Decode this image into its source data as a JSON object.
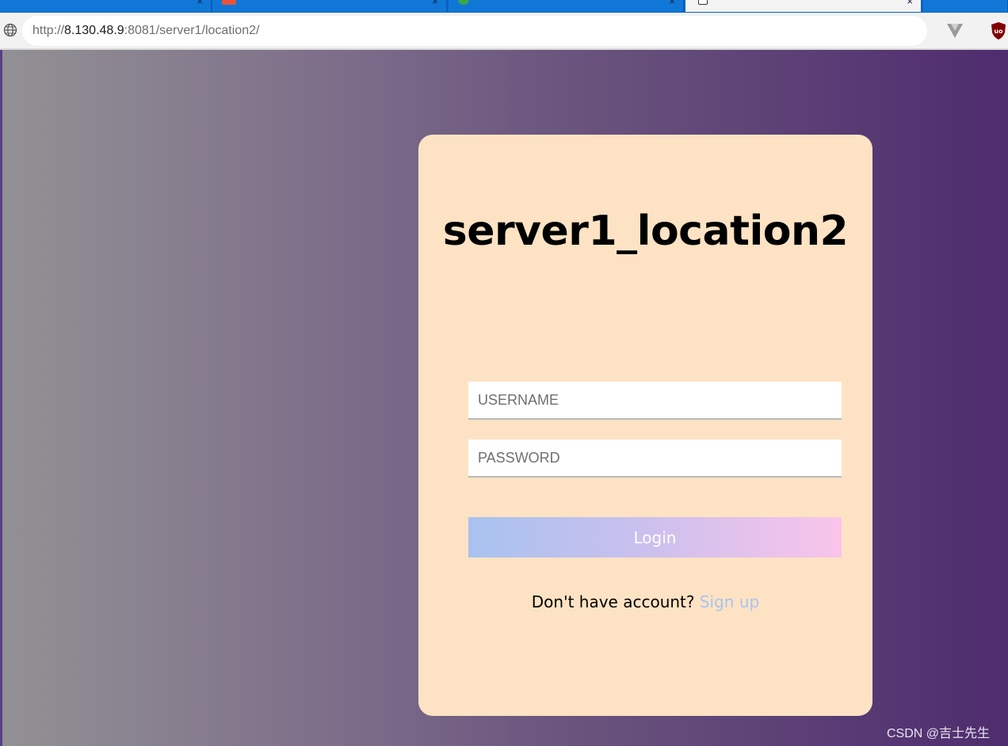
{
  "browser": {
    "url_prefix": "http://",
    "url_host": "8.130.48.9",
    "url_rest": ":8081/server1/location2/",
    "tab_close": "×"
  },
  "login": {
    "title": "server1_location2",
    "username_placeholder": "USERNAME",
    "password_placeholder": "PASSWORD",
    "button_label": "Login",
    "signup_prompt": "Don't have account? ",
    "signup_link": "Sign up"
  },
  "watermark": "CSDN @吉士先生",
  "colors": {
    "card_background": "#fde3c4",
    "link": "#a9c3ee",
    "button_gradient_start": "#a8c2ef",
    "button_gradient_end": "#f9c4ea"
  },
  "icons": {
    "address_bar": "globe-icon",
    "extension_1": "vue-devtools-icon",
    "extension_2": "ublock-origin-icon"
  }
}
